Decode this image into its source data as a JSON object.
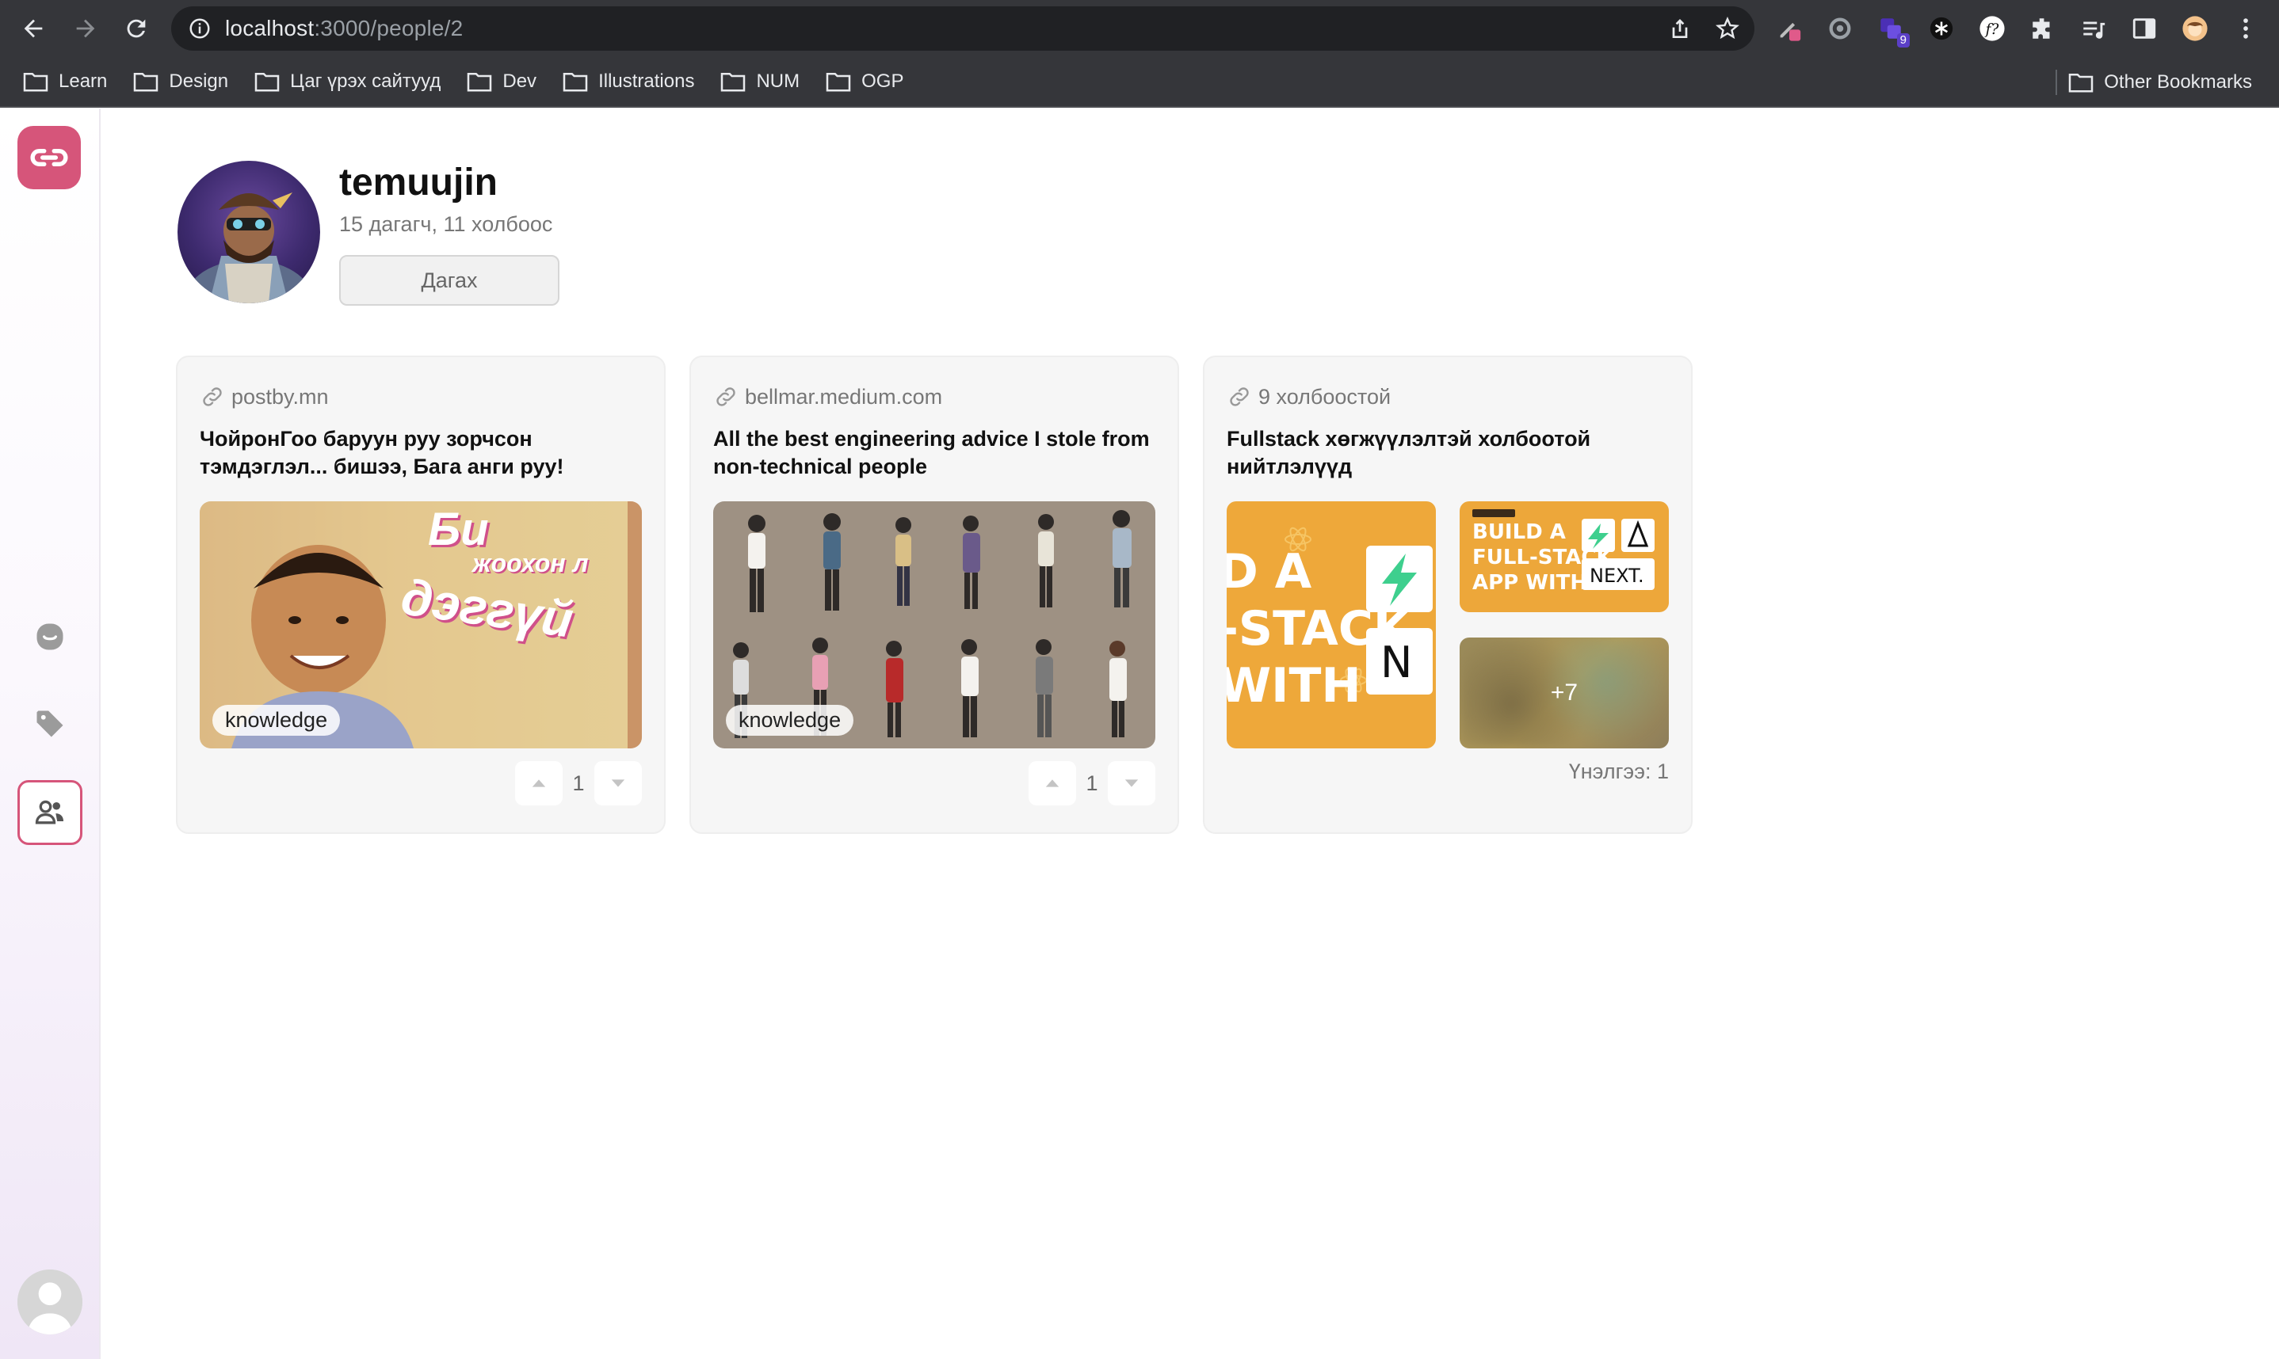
{
  "browser": {
    "url_host": "localhost",
    "url_rest": ":3000/people/2",
    "bookmarks": [
      "Learn",
      "Design",
      "Цаг үрэх сайтууд",
      "Dev",
      "Illustrations",
      "NUM",
      "OGP"
    ],
    "other_bookmarks": "Other Bookmarks",
    "extension_badge": "9"
  },
  "sidebar": {
    "items": [
      {
        "icon": "smile-icon"
      },
      {
        "icon": "tag-icon"
      },
      {
        "icon": "people-icon",
        "active": true
      }
    ],
    "accent": "#d6557a"
  },
  "profile": {
    "username": "temuujin",
    "stats": "15 дагагч, 11 холбоос",
    "follow_label": "Дагах"
  },
  "cards": [
    {
      "domain": "postby.mn",
      "title": "ЧойронГоо баруун руу зорчсон тэмдэглэл... бишээ, Бага анги руу!",
      "image_text": [
        "Би",
        "жоохон л",
        "дэггүй"
      ],
      "tag": "knowledge",
      "votes": "1"
    },
    {
      "domain": "bellmar.medium.com",
      "title": "All the best engineering advice I stole from non-technical people",
      "tag": "knowledge",
      "votes": "1"
    },
    {
      "domain": "9 холбоостой",
      "title": "Fullstack хөгжүүлэлтэй холбоотой нийтлэлүүд",
      "mini_left_text": [
        "D A",
        "-STACK",
        "WITH"
      ],
      "mini_right_top_text": [
        "BUILD A",
        "FULL-STACK",
        "APP WITH",
        "NEXT."
      ],
      "more_count": "+7",
      "rating": "Үнэлгээ: 1"
    }
  ]
}
